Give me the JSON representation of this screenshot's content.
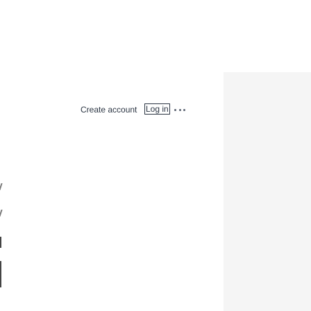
{
  "header": {
    "create_account_label": "Create account",
    "login_label": "Log in",
    "more_icon": "ellipsis-icon"
  }
}
